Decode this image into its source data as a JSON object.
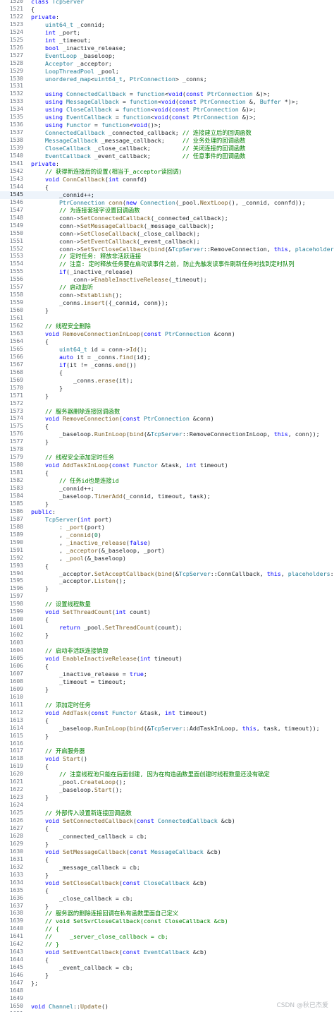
{
  "editor": {
    "current_line": 1545,
    "lines": [
      {
        "n": "1520",
        "text": "class TcpServer"
      },
      {
        "n": "1521",
        "text": "{"
      },
      {
        "n": "1522",
        "text": "private:"
      },
      {
        "n": "1523",
        "text": "    uint64_t _connid;"
      },
      {
        "n": "1524",
        "text": "    int _port;"
      },
      {
        "n": "1525",
        "text": "    int _timeout;"
      },
      {
        "n": "1526",
        "text": "    bool _inactive_release;"
      },
      {
        "n": "1527",
        "text": "    EventLoop _baseloop;"
      },
      {
        "n": "1528",
        "text": "    Acceptor _acceptor;"
      },
      {
        "n": "1529",
        "text": "    LoopThreadPool _pool;"
      },
      {
        "n": "1530",
        "text": "    unordered_map<uint64_t, PtrConnection> _conns;"
      },
      {
        "n": "1531",
        "text": ""
      },
      {
        "n": "1532",
        "text": "    using ConnectedCallback = function<void(const PtrConnection &)>;"
      },
      {
        "n": "1533",
        "text": "    using MessageCallback = function<void(const PtrConnection &, Buffer *)>;"
      },
      {
        "n": "1534",
        "text": "    using CloseCallback = function<void(const PtrConnection &)>;"
      },
      {
        "n": "1535",
        "text": "    using EventCallback = function<void(const PtrConnection &)>;"
      },
      {
        "n": "1536",
        "text": "    using Functor = function<void()>;"
      },
      {
        "n": "1537",
        "text": "    ConnectedCallback _connected_callback; // 连接建立后的回调函数"
      },
      {
        "n": "1538",
        "text": "    MessageCallback _message_callback;     // 业务处理的回调函数"
      },
      {
        "n": "1539",
        "text": "    CloseCallback _close_callback;         // 关闭连接的回调函数"
      },
      {
        "n": "1540",
        "text": "    EventCallback _event_callback;         // 任意事件的回调函数"
      },
      {
        "n": "1541",
        "text": "private:"
      },
      {
        "n": "1542",
        "text": "    // 获得新连接后的设置(相当于_acceptor读回调)"
      },
      {
        "n": "1543",
        "text": "    void ConnCallback(int connfd)"
      },
      {
        "n": "1544",
        "text": "    {"
      },
      {
        "n": "1545",
        "text": "        _connid++;"
      },
      {
        "n": "1546",
        "text": "        PtrConnection conn(new Connection(_pool.NextLoop(), _connid, connfd));"
      },
      {
        "n": "1547",
        "text": "        // 为连接套接字设置回调函数"
      },
      {
        "n": "1548",
        "text": "        conn->SetConnectedCallback(_connected_callback);"
      },
      {
        "n": "1549",
        "text": "        conn->SetMessageCallback(_message_callback);"
      },
      {
        "n": "1550",
        "text": "        conn->SetCloseCallback(_close_callback);"
      },
      {
        "n": "1551",
        "text": "        conn->SetEventCallback(_event_callback);"
      },
      {
        "n": "1552",
        "text": "        conn->SetSvrCloseCallback(bind(&TcpServer::RemoveConnection, this, placeholders::_1));"
      },
      {
        "n": "1553",
        "text": "        // 定时任务: 释放非活跃连接"
      },
      {
        "n": "1554",
        "text": "        // 注意: 定时释放任务要在启动读事件之前, 防止先触发读事件刷新任务时找到定时队列"
      },
      {
        "n": "1555",
        "text": "        if(_inactive_release)"
      },
      {
        "n": "1556",
        "text": "            conn->EnableInactiveRelease(_timeout);"
      },
      {
        "n": "1557",
        "text": "        // 启动监听"
      },
      {
        "n": "1558",
        "text": "        conn->Establish();"
      },
      {
        "n": "1559",
        "text": "        _conns.insert({_connid, conn});"
      },
      {
        "n": "1560",
        "text": "    }"
      },
      {
        "n": "1561",
        "text": ""
      },
      {
        "n": "1562",
        "text": "    // 线程安全删除"
      },
      {
        "n": "1563",
        "text": "    void RemoveConnectionInLoop(const PtrConnection &conn)"
      },
      {
        "n": "1564",
        "text": "    {"
      },
      {
        "n": "1565",
        "text": "        uint64_t id = conn->Id();"
      },
      {
        "n": "1566",
        "text": "        auto it = _conns.find(id);"
      },
      {
        "n": "1567",
        "text": "        if(it != _conns.end())"
      },
      {
        "n": "1568",
        "text": "        {"
      },
      {
        "n": "1569",
        "text": "            _conns.erase(it);"
      },
      {
        "n": "1570",
        "text": "        }"
      },
      {
        "n": "1571",
        "text": "    }"
      },
      {
        "n": "1572",
        "text": ""
      },
      {
        "n": "1573",
        "text": "    // 服务器删除连接回调函数"
      },
      {
        "n": "1574",
        "text": "    void RemoveConnection(const PtrConnection &conn)"
      },
      {
        "n": "1575",
        "text": "    {"
      },
      {
        "n": "1576",
        "text": "        _baseloop.RunInLoop(bind(&TcpServer::RemoveConnectionInLoop, this, conn));"
      },
      {
        "n": "1577",
        "text": "    }"
      },
      {
        "n": "1578",
        "text": ""
      },
      {
        "n": "1579",
        "text": "    // 线程安全添加定时任务"
      },
      {
        "n": "1580",
        "text": "    void AddTaskInLoop(const Functor &task, int timeout)"
      },
      {
        "n": "1581",
        "text": "    {"
      },
      {
        "n": "1582",
        "text": "        // 任务id也是连接id"
      },
      {
        "n": "1583",
        "text": "        _connid++;"
      },
      {
        "n": "1584",
        "text": "        _baseloop.TimerAdd(_connid, timeout, task);"
      },
      {
        "n": "1585",
        "text": "    }"
      },
      {
        "n": "1586",
        "text": "public:"
      },
      {
        "n": "1587",
        "text": "    TcpServer(int port)"
      },
      {
        "n": "1588",
        "text": "        : _port(port)"
      },
      {
        "n": "1589",
        "text": "        , _connid(0)"
      },
      {
        "n": "1590",
        "text": "        , _inactive_release(false)"
      },
      {
        "n": "1591",
        "text": "        , _acceptor(&_baseloop, _port)"
      },
      {
        "n": "1592",
        "text": "        , _pool(&_baseloop)"
      },
      {
        "n": "1593",
        "text": "    {"
      },
      {
        "n": "1594",
        "text": "        _acceptor.SetAcceptCallback(bind(&TcpServer::ConnCallback, this, placeholders::_1));"
      },
      {
        "n": "1595",
        "text": "        _acceptor.Listen();"
      },
      {
        "n": "1596",
        "text": "    }"
      },
      {
        "n": "1597",
        "text": ""
      },
      {
        "n": "1598",
        "text": "    // 设置线程数量"
      },
      {
        "n": "1599",
        "text": "    void SetThreadCount(int count)"
      },
      {
        "n": "1600",
        "text": "    {"
      },
      {
        "n": "1601",
        "text": "        return _pool.SetThreadCount(count);"
      },
      {
        "n": "1602",
        "text": "    }"
      },
      {
        "n": "1603",
        "text": ""
      },
      {
        "n": "1604",
        "text": "    // 启动非活跃连接销毁"
      },
      {
        "n": "1605",
        "text": "    void EnableInactiveRelease(int timeout)"
      },
      {
        "n": "1606",
        "text": "    {"
      },
      {
        "n": "1607",
        "text": "        _inactive_release = true;"
      },
      {
        "n": "1608",
        "text": "        _timeout = timeout;"
      },
      {
        "n": "1609",
        "text": "    }"
      },
      {
        "n": "1610",
        "text": ""
      },
      {
        "n": "1611",
        "text": "    // 添加定时任务"
      },
      {
        "n": "1612",
        "text": "    void AddTask(const Functor &task, int timeout)"
      },
      {
        "n": "1613",
        "text": "    {"
      },
      {
        "n": "1614",
        "text": "        _baseloop.RunInLoop(bind(&TcpServer::AddTaskInLoop, this, task, timeout));"
      },
      {
        "n": "1615",
        "text": "    }"
      },
      {
        "n": "1616",
        "text": ""
      },
      {
        "n": "1617",
        "text": "    // 开启服务器"
      },
      {
        "n": "1618",
        "text": "    void Start()"
      },
      {
        "n": "1619",
        "text": "    {"
      },
      {
        "n": "1620",
        "text": "        // 注意线程池只能在后面创建, 因为在构造函数里面创建时线程数量还没有确定"
      },
      {
        "n": "1621",
        "text": "        _pool.CreateLoop();"
      },
      {
        "n": "1622",
        "text": "        _baseloop.Start();"
      },
      {
        "n": "1623",
        "text": "    }"
      },
      {
        "n": "1624",
        "text": ""
      },
      {
        "n": "1625",
        "text": "    // 外部传入设置新连接回调函数"
      },
      {
        "n": "1626",
        "text": "    void SetConnectedCallback(const ConnectedCallback &cb)"
      },
      {
        "n": "1627",
        "text": "    {"
      },
      {
        "n": "1628",
        "text": "        _connected_callback = cb;"
      },
      {
        "n": "1629",
        "text": "    }"
      },
      {
        "n": "1630",
        "text": "    void SetMessageCallback(const MessageCallback &cb)"
      },
      {
        "n": "1631",
        "text": "    {"
      },
      {
        "n": "1632",
        "text": "        _message_callback = cb;"
      },
      {
        "n": "1633",
        "text": "    }"
      },
      {
        "n": "1634",
        "text": "    void SetCloseCallback(const CloseCallback &cb)"
      },
      {
        "n": "1635",
        "text": "    {"
      },
      {
        "n": "1636",
        "text": "        _close_callback = cb;"
      },
      {
        "n": "1637",
        "text": "    }"
      },
      {
        "n": "1638",
        "text": "    // 服务器的删除连接回调在私有函数里面自己定义"
      },
      {
        "n": "1639",
        "text": "    // void SetSvrCloseCallback(const CloseCallback &cb)"
      },
      {
        "n": "1640",
        "text": "    // {"
      },
      {
        "n": "1641",
        "text": "    //     _server_close_callback = cb;"
      },
      {
        "n": "1642",
        "text": "    // }"
      },
      {
        "n": "1643",
        "text": "    void SetEventCallback(const EventCallback &cb)"
      },
      {
        "n": "1644",
        "text": "    {"
      },
      {
        "n": "1645",
        "text": "        _event_callback = cb;"
      },
      {
        "n": "1646",
        "text": "    }"
      },
      {
        "n": "1647",
        "text": "};"
      },
      {
        "n": "1648",
        "text": ""
      },
      {
        "n": "1649",
        "text": ""
      },
      {
        "n": "1650",
        "text": "void Channel::Update()"
      },
      {
        "n": "1651",
        "text": "{"
      }
    ]
  },
  "watermark": "CSDN @秋已杰爱",
  "colors": {
    "background": "#ffffff",
    "keyword": "#0000ff",
    "type": "#267f99",
    "comment": "#008000",
    "string": "#a31515",
    "function": "#795e26",
    "line_number": "#6e7681"
  }
}
